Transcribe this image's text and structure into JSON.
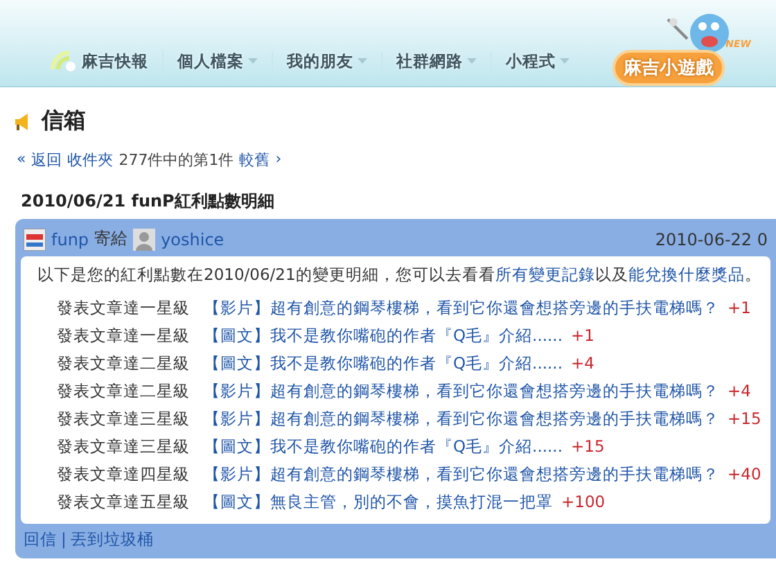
{
  "nav": [
    {
      "label": "麻吉快報",
      "has_menu": false
    },
    {
      "label": "個人檔案",
      "has_menu": true
    },
    {
      "label": "我的朋友",
      "has_menu": true
    },
    {
      "label": "社群網路",
      "has_menu": true
    },
    {
      "label": "小程式",
      "has_menu": true
    }
  ],
  "logo": {
    "text": "麻吉小遊戲",
    "badge": "NEW"
  },
  "page_title": "信箱",
  "breadcrumb": {
    "prefix": "«",
    "back": "返回",
    "folder": "收件夾",
    "position": "277件中的第1件",
    "older": "較舊",
    "suffix": "›"
  },
  "subject": "2010/06/21 funP紅利點數明細",
  "message": {
    "sender": "funp",
    "sent_to": "寄給",
    "recipient": "yoshice",
    "date": "2010-06-22 0",
    "intro": "以下是您的紅利點數在2010/06/21的變更明細，您可以去看看",
    "intro_link_1": "所有變更記錄",
    "intro_joiner": "以及",
    "intro_link_2": "能兌換什麼獎品",
    "intro_end": "。",
    "rows": [
      {
        "label": "發表文章達一星級",
        "tag": "【影片】",
        "title": "超有創意的鋼琴樓梯，看到它你還會想搭旁邊的手扶電梯嗎？",
        "points": "+1"
      },
      {
        "label": "發表文章達一星級",
        "tag": "【圖文】",
        "title": "我不是教你嘴砲的作者『Q毛』介紹......",
        "points": "+1"
      },
      {
        "label": "發表文章達二星級",
        "tag": "【圖文】",
        "title": "我不是教你嘴砲的作者『Q毛』介紹......",
        "points": "+4"
      },
      {
        "label": "發表文章達二星級",
        "tag": "【影片】",
        "title": "超有創意的鋼琴樓梯，看到它你還會想搭旁邊的手扶電梯嗎？",
        "points": "+4"
      },
      {
        "label": "發表文章達三星級",
        "tag": "【影片】",
        "title": "超有創意的鋼琴樓梯，看到它你還會想搭旁邊的手扶電梯嗎？",
        "points": "+15"
      },
      {
        "label": "發表文章達三星級",
        "tag": "【圖文】",
        "title": "我不是教你嘴砲的作者『Q毛』介紹......",
        "points": "+15"
      },
      {
        "label": "發表文章達四星級",
        "tag": "【影片】",
        "title": "超有創意的鋼琴樓梯，看到它你還會想搭旁邊的手扶電梯嗎？",
        "points": "+40"
      },
      {
        "label": "發表文章達五星級",
        "tag": "【圖文】",
        "title": "無良主管，別的不會，摸魚打混一把罩",
        "points": "+100"
      }
    ]
  },
  "actions": {
    "reply": "回信",
    "separator": "|",
    "trash": "丟到垃圾桶"
  }
}
